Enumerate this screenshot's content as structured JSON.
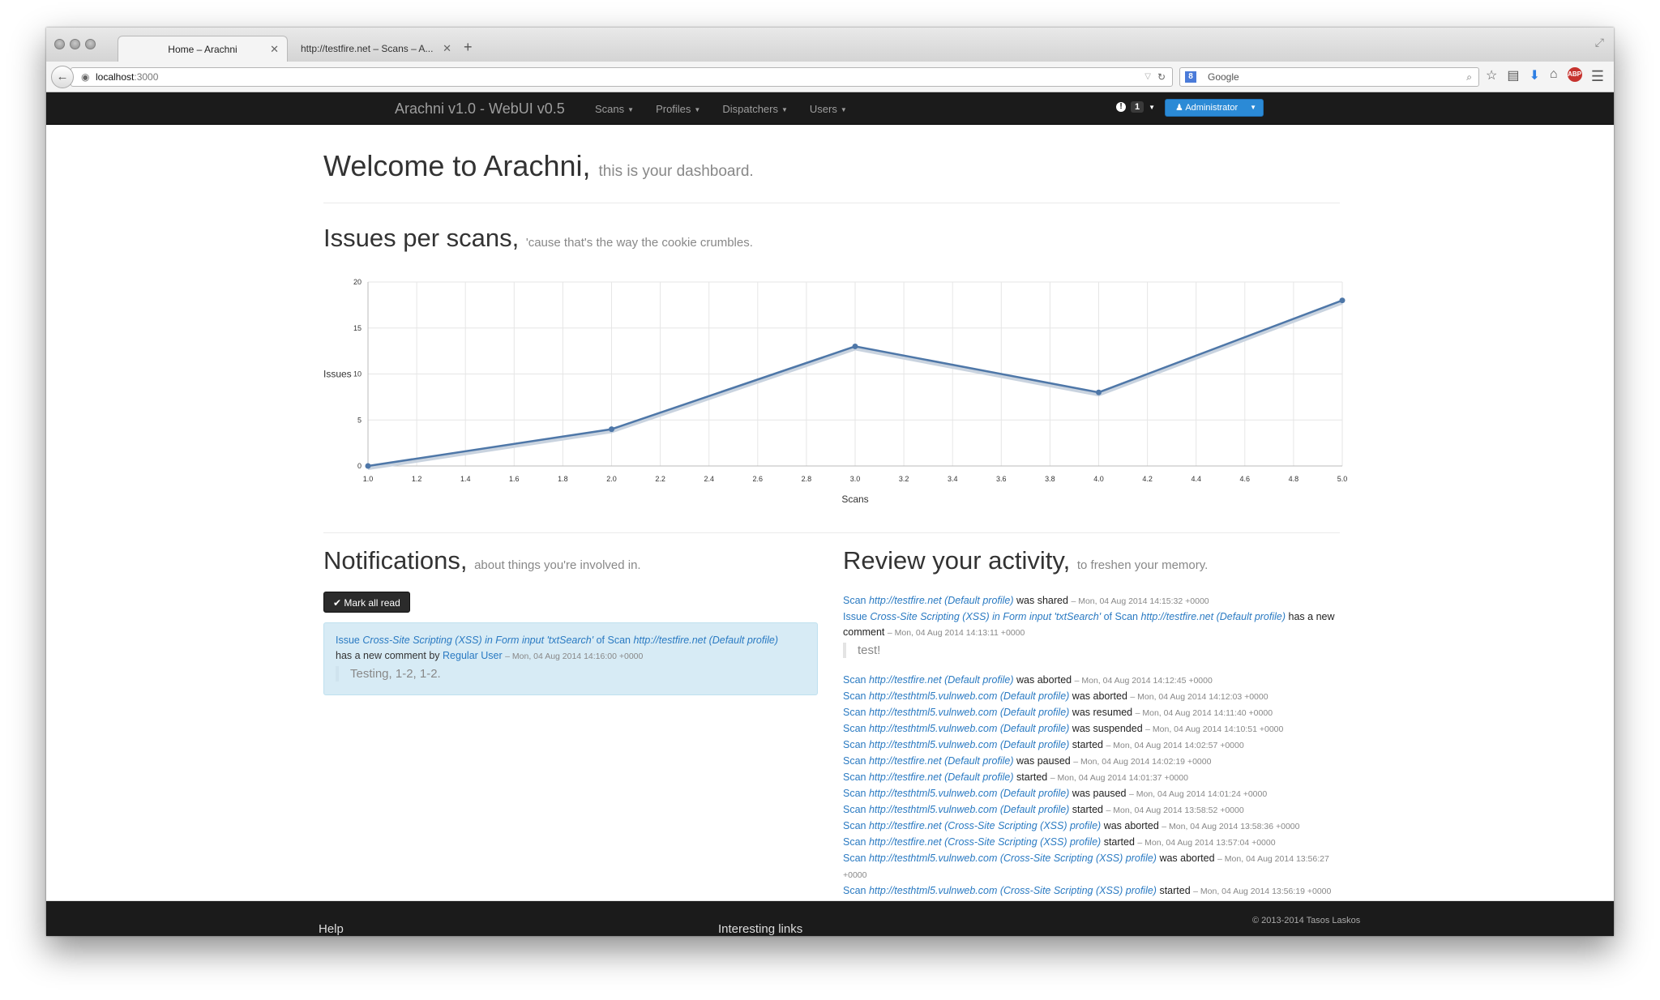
{
  "browser": {
    "tabs": [
      {
        "label": "Home – Arachni",
        "close": "✕"
      },
      {
        "label": "http://testfire.net – Scans – A...",
        "close": "✕"
      }
    ],
    "new_tab": "+",
    "url_host": "localhost",
    "url_port": ":3000",
    "search_engine_icon": "8",
    "search_placeholder": "Google"
  },
  "navbar": {
    "brand": "Arachni v1.0 - WebUI v0.5",
    "links": [
      "Scans",
      "Profiles",
      "Dispatchers",
      "Users"
    ],
    "notification_count": "1",
    "user_button": "Administrator",
    "accent": "#2b8ad6"
  },
  "welcome": {
    "title": "Welcome to Arachni,",
    "subtitle": "this is your dashboard."
  },
  "issues": {
    "title": "Issues per scans,",
    "subtitle": "'cause that's the way the cookie crumbles."
  },
  "chart_data": {
    "type": "line",
    "x": [
      1,
      2,
      3,
      4,
      5
    ],
    "values": [
      0,
      4,
      13,
      8,
      18
    ],
    "xlabel": "Scans",
    "ylabel": "Issues",
    "xlim": [
      1.0,
      5.0
    ],
    "ylim": [
      0,
      20
    ],
    "xticks": [
      "1.0",
      "1.2",
      "1.4",
      "1.6",
      "1.8",
      "2.0",
      "2.2",
      "2.4",
      "2.6",
      "2.8",
      "3.0",
      "3.2",
      "3.4",
      "3.6",
      "3.8",
      "4.0",
      "4.2",
      "4.4",
      "4.6",
      "4.8",
      "5.0"
    ],
    "yticks": [
      "0",
      "5",
      "10",
      "15",
      "20"
    ],
    "grid": true,
    "color": "#4e77a8"
  },
  "notifications": {
    "title": "Notifications,",
    "subtitle": "about things you're involved in.",
    "mark_all": "Mark all read",
    "item": {
      "w1": "Issue",
      "issue": "Cross-Site Scripting (XSS) in Form input 'txtSearch'",
      "w2": "of Scan",
      "scan": "http://testfire.net (Default profile)",
      "w3": "has a new comment by",
      "user": "Regular User",
      "time": "– Mon, 04 Aug 2014 14:16:00 +0000",
      "comment": "Testing, 1-2, 1-2."
    }
  },
  "activity": {
    "title": "Review your activity,",
    "subtitle": "to freshen your memory.",
    "first": {
      "w": "Scan",
      "scan": "http://testfire.net (Default profile)",
      "action": "was shared",
      "time": "– Mon, 04 Aug 2014 14:15:32 +0000"
    },
    "issue_item": {
      "w1": "Issue",
      "issue": "Cross-Site Scripting (XSS) in Form input 'txtSearch'",
      "w2": "of Scan",
      "scan": "http://testfire.net (Default profile)",
      "w3": "has a new comment",
      "time": "– Mon, 04 Aug 2014 14:13:11 +0000",
      "comment": "test!"
    },
    "items": [
      {
        "scan": "http://testfire.net (Default profile)",
        "action": "was aborted",
        "time": "– Mon, 04 Aug 2014 14:12:45 +0000"
      },
      {
        "scan": "http://testhtml5.vulnweb.com (Default profile)",
        "action": "was aborted",
        "time": "– Mon, 04 Aug 2014 14:12:03 +0000"
      },
      {
        "scan": "http://testhtml5.vulnweb.com (Default profile)",
        "action": "was resumed",
        "time": "– Mon, 04 Aug 2014 14:11:40 +0000"
      },
      {
        "scan": "http://testhtml5.vulnweb.com (Default profile)",
        "action": "was suspended",
        "time": "– Mon, 04 Aug 2014 14:10:51 +0000"
      },
      {
        "scan": "http://testhtml5.vulnweb.com (Default profile)",
        "action": "started",
        "time": "– Mon, 04 Aug 2014 14:02:57 +0000"
      },
      {
        "scan": "http://testfire.net (Default profile)",
        "action": "was paused",
        "time": "– Mon, 04 Aug 2014 14:02:19 +0000"
      },
      {
        "scan": "http://testfire.net (Default profile)",
        "action": "started",
        "time": "– Mon, 04 Aug 2014 14:01:37 +0000"
      },
      {
        "scan": "http://testhtml5.vulnweb.com (Default profile)",
        "action": "was paused",
        "time": "– Mon, 04 Aug 2014 14:01:24 +0000"
      },
      {
        "scan": "http://testhtml5.vulnweb.com (Default profile)",
        "action": "started",
        "time": "– Mon, 04 Aug 2014 13:58:52 +0000"
      },
      {
        "scan": "http://testfire.net (Cross-Site Scripting (XSS) profile)",
        "action": "was aborted",
        "time": "– Mon, 04 Aug 2014 13:58:36 +0000"
      },
      {
        "scan": "http://testfire.net (Cross-Site Scripting (XSS) profile)",
        "action": "started",
        "time": "– Mon, 04 Aug 2014 13:57:04 +0000"
      },
      {
        "scan": "http://testhtml5.vulnweb.com (Cross-Site Scripting (XSS) profile)",
        "action": "was aborted",
        "time": "– Mon, 04 Aug 2014 13:56:27 +0000"
      },
      {
        "scan": "http://testhtml5.vulnweb.com (Cross-Site Scripting (XSS) profile)",
        "action": "started",
        "time": "– Mon, 04 Aug 2014 13:56:19 +0000"
      }
    ]
  },
  "footer": {
    "help": "Help",
    "links": "Interesting links",
    "copyright": "© 2013-2014 Tasos Laskos"
  }
}
